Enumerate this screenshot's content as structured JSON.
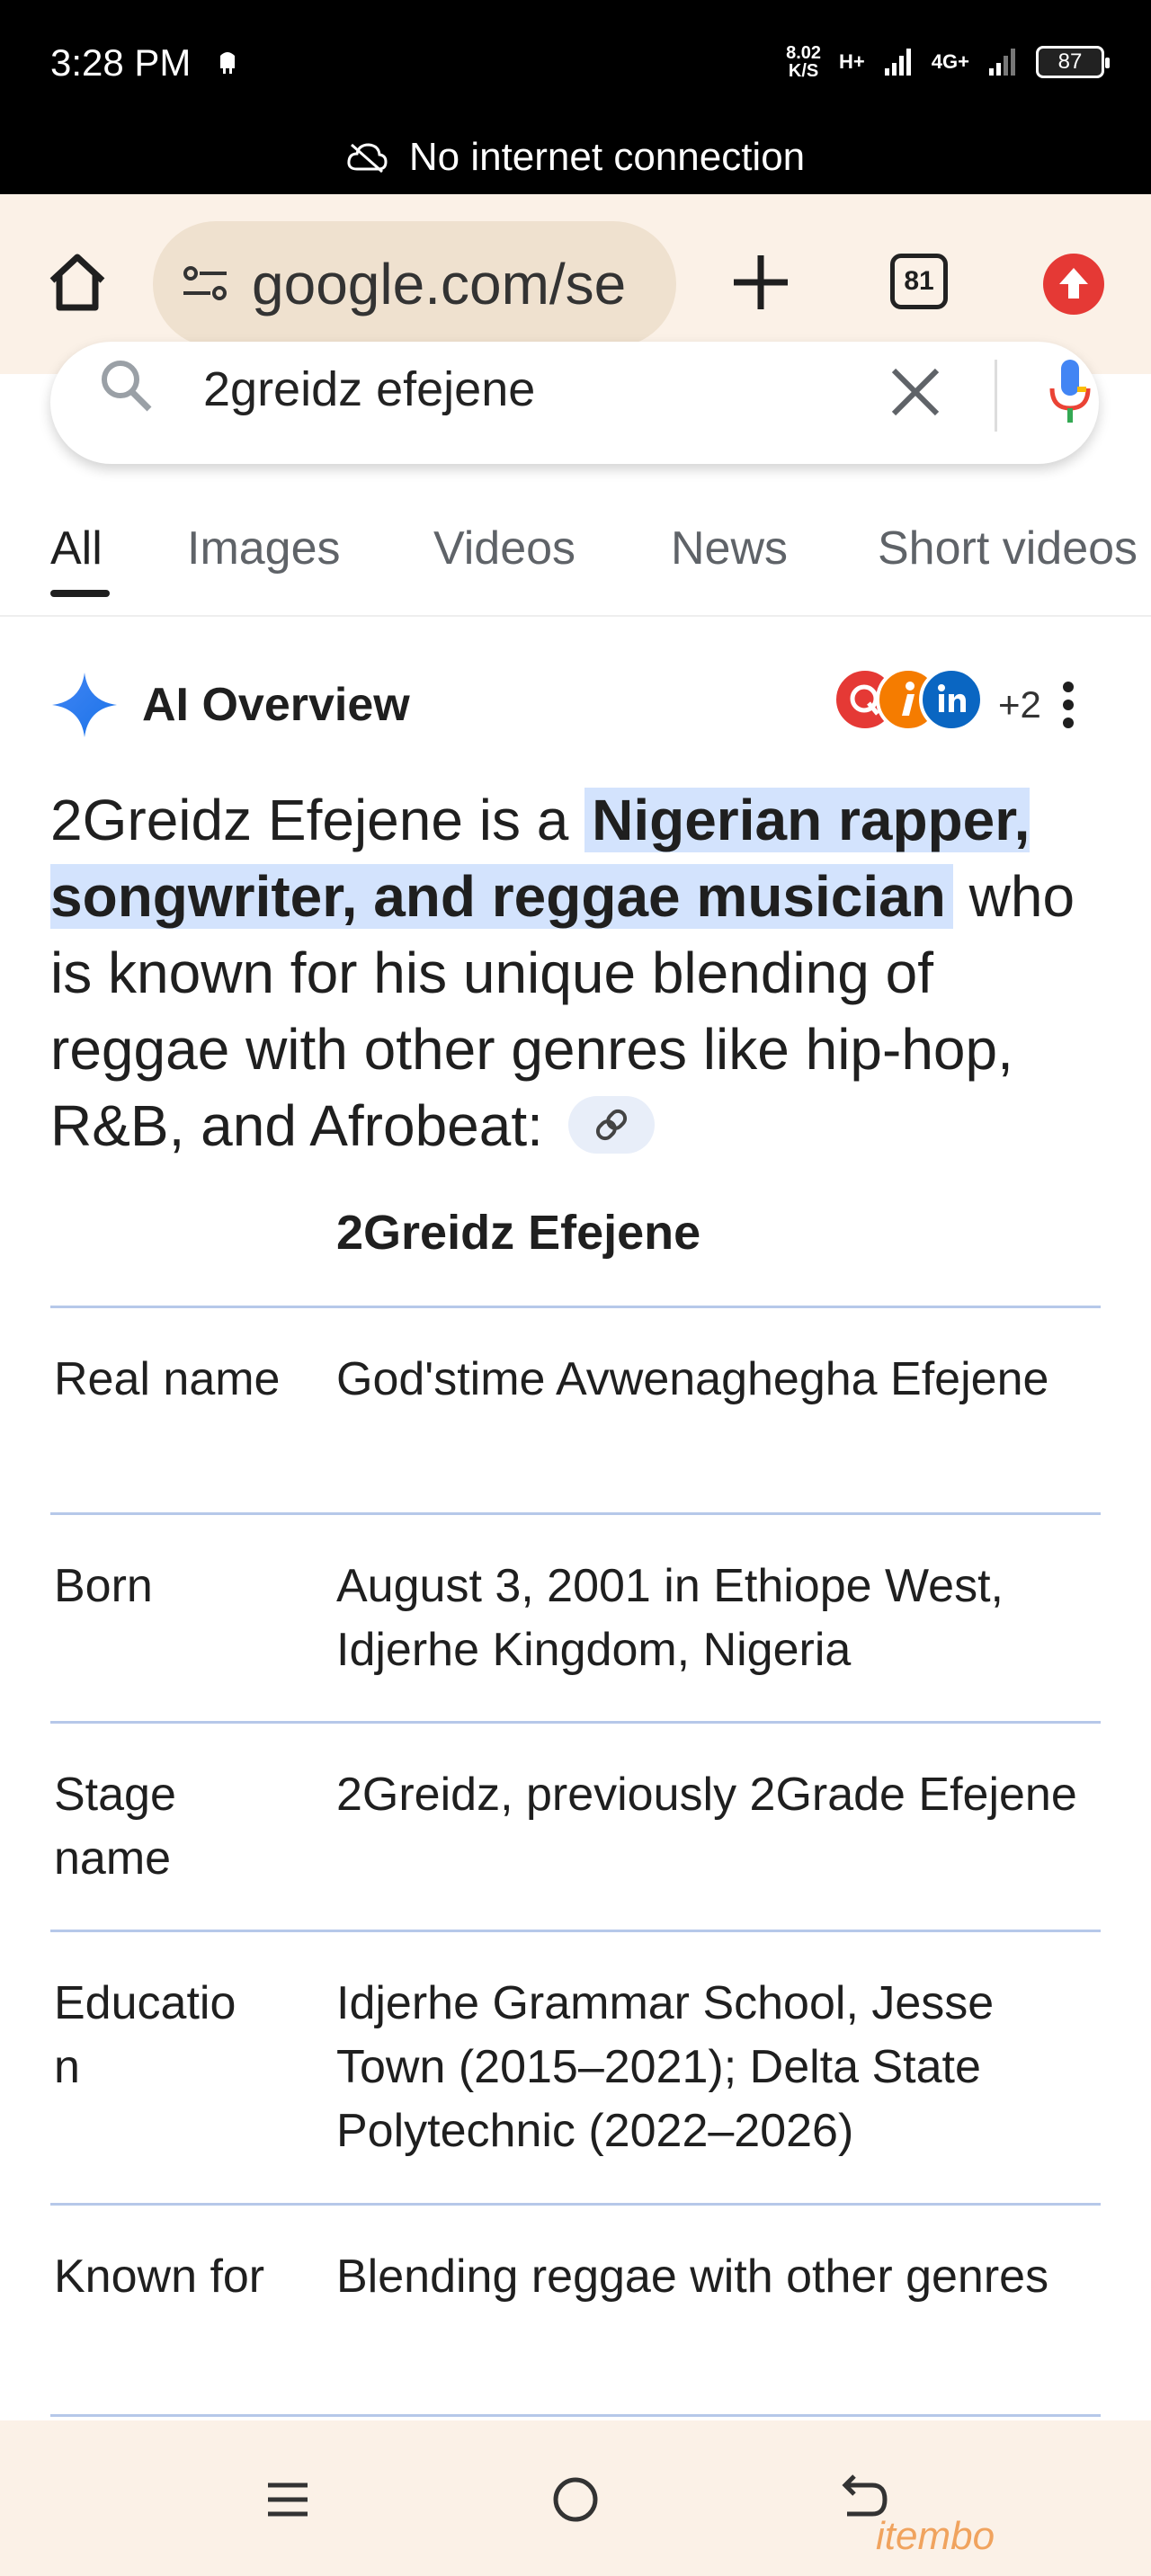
{
  "status_bar": {
    "time": "3:28 PM",
    "speed_value": "8.02",
    "speed_unit": "K/S",
    "net1": "H+",
    "net2": "4G+",
    "battery": "87",
    "offline_text": "No internet connection"
  },
  "browser": {
    "url": "google.com/se",
    "tab_count": "81"
  },
  "search": {
    "query": "2greidz efejene"
  },
  "tabs": [
    "All",
    "Images",
    "Videos",
    "News",
    "Short videos"
  ],
  "ai_overview": {
    "title": "AI Overview",
    "sources_more": "+2",
    "summary_intro": "2Greidz Efejene is a ",
    "summary_highlight": "Nigerian rapper, songwriter, and reggae musician",
    "summary_rest": " who is known for his unique blending of reggae with other genres like hip-hop, R&B, and Afrobeat:",
    "table_title": "2Greidz Efejene",
    "rows": [
      {
        "label": "Real name",
        "value": "God'stime Avwenaghegha Efejene"
      },
      {
        "label": "Born",
        "value": "August 3, 2001 in Ethiope West, Idjerhe Kingdom, Nigeria"
      },
      {
        "label": "Stage name",
        "value": "2Greidz, previously 2Grade Efejene"
      },
      {
        "label": "Educatio n",
        "value": "Idjerhe Grammar School, Jesse Town (2015–2021); Delta State Polytechnic (2022–2026)"
      },
      {
        "label": "Known for",
        "value": "Blending reggae with other genres"
      }
    ]
  },
  "watermark": "itembo",
  "colors": {
    "highlight": "#d3e3fd",
    "toolbar_bg": "#fbf1e7",
    "url_bg": "#efe1cf",
    "divider": "#b6c8e9"
  }
}
